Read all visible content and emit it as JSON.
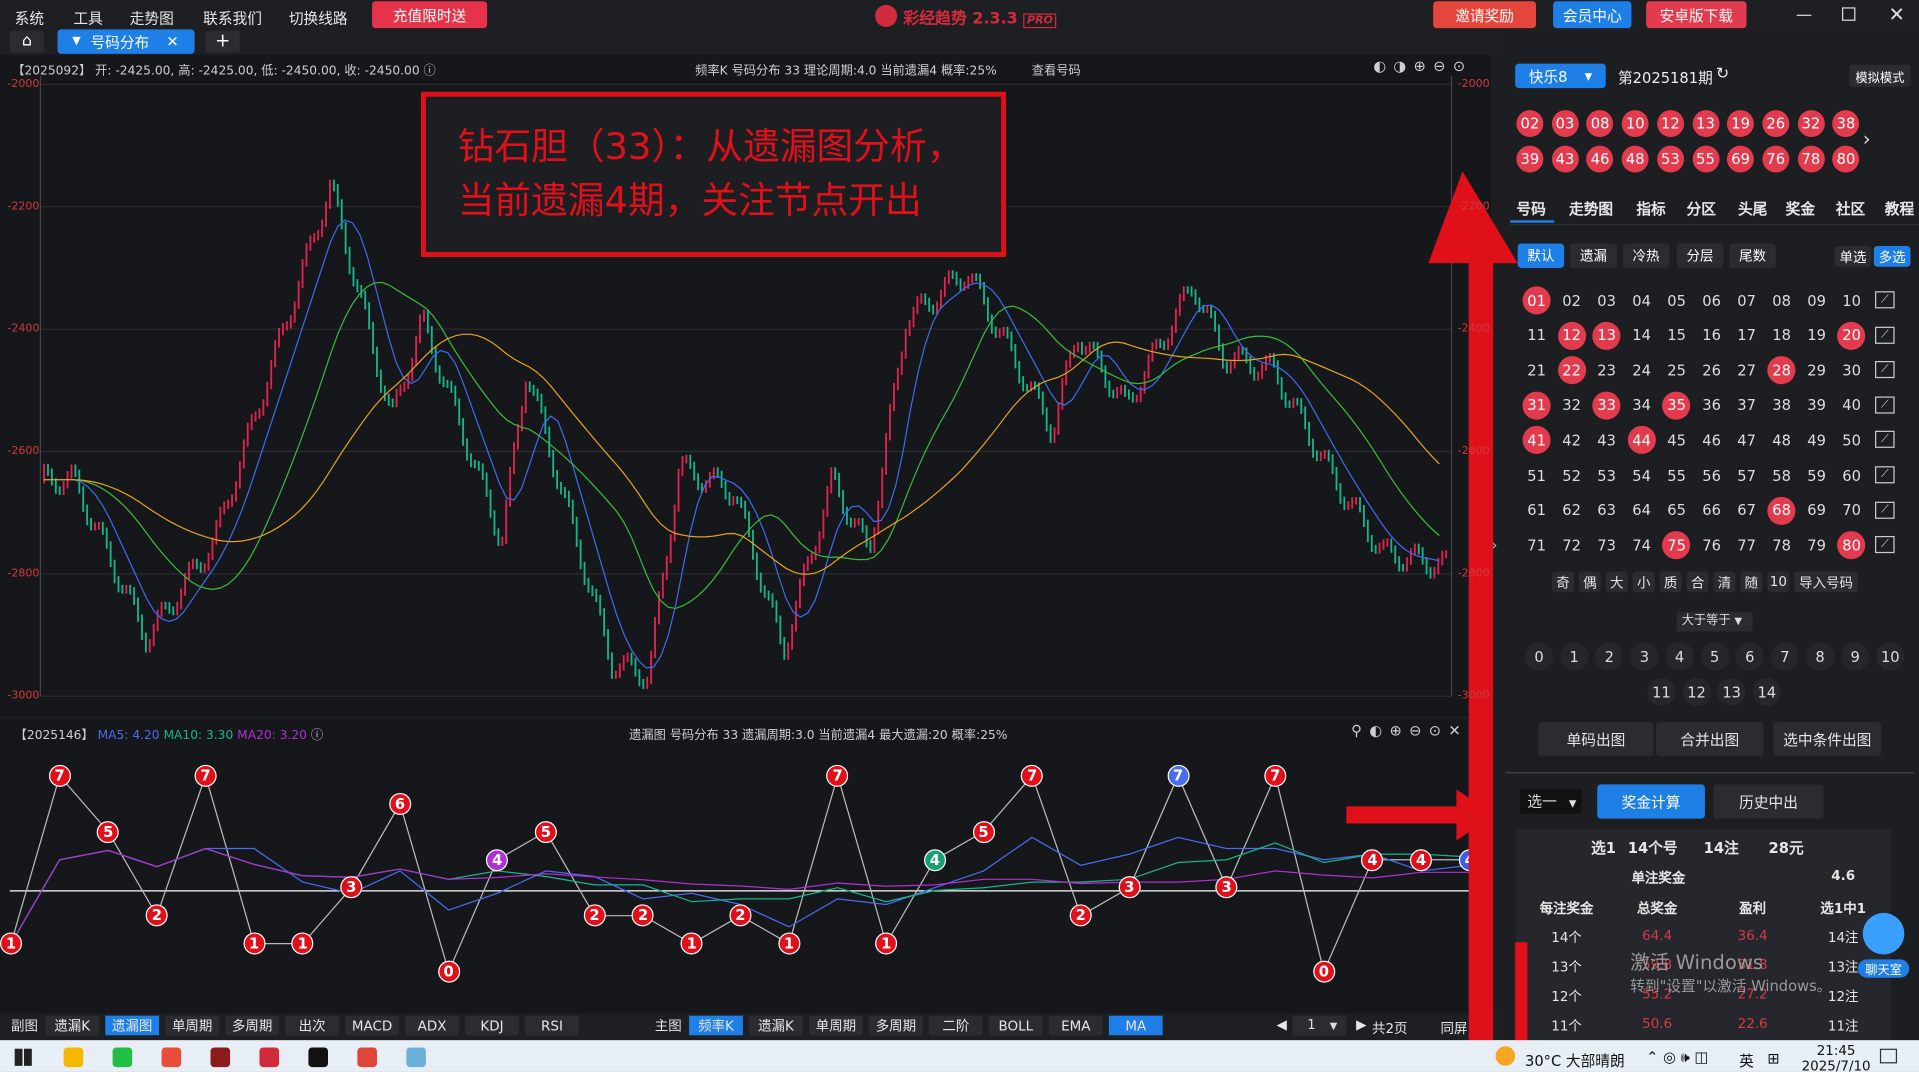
{
  "menu": [
    "系统",
    "工具",
    "走势图",
    "联系我们",
    "切换线路"
  ],
  "promo_button": "充值限时送",
  "app_title": "彩经趋势 2.3.3",
  "app_badge": "PRO",
  "invite_label": "邀请奖励",
  "member_label": "会员中心",
  "android_label": "安卓版下载",
  "tab_label": "号码分布",
  "main_header": {
    "period": "【2025092】",
    "ohlc": "开: -2425.00, 高: -2425.00, 低: -2450.00, 收: -2450.00",
    "right": "频率K  号码分布  33    理论周期:4.0  当前遗漏4  概率:25%",
    "view": "查看号码"
  },
  "y_axis": [
    "-2000",
    "-2200",
    "-2400",
    "-2600",
    "-2800",
    "-3000"
  ],
  "annotation": [
    "钻石胆（33）：从遗漏图分析，",
    "当前遗漏4期，关注节点开出"
  ],
  "sub_header": {
    "period": "【2025146】",
    "ma5": "MA5: 4.20",
    "ma10": "MA10: 3.30",
    "ma20": "MA20: 3.20",
    "right": "遗漏图  号码分布  33    遗漏周期:3.0  当前遗漏4  最大遗漏:20  概率:25%"
  },
  "chart_data": {
    "type": "line",
    "title": "遗漏图",
    "series": [
      {
        "name": "33",
        "values": [
          1,
          7,
          5,
          2,
          7,
          1,
          1,
          3,
          6,
          0,
          4,
          5,
          2,
          2,
          1,
          2,
          1,
          7,
          1,
          4,
          5,
          7,
          2,
          3,
          7,
          3,
          7,
          0,
          4,
          4,
          4
        ]
      }
    ]
  },
  "bottom_left": [
    "副图",
    "遗漏K",
    "遗漏图",
    "单周期",
    "多周期",
    "出次",
    "MACD",
    "ADX",
    "KDJ",
    "RSI"
  ],
  "bottom_right": [
    "主图",
    "频率K",
    "遗漏K",
    "单周期",
    "多周期",
    "二阶",
    "BOLL",
    "EMA",
    "MA"
  ],
  "page": {
    "current": "1",
    "total": "共2页",
    "sync": "同屏"
  },
  "right": {
    "lottery": "快乐8",
    "issue": "第2025181期",
    "mode": "模拟模式",
    "drawn": [
      "02",
      "03",
      "08",
      "10",
      "12",
      "13",
      "19",
      "26",
      "32",
      "38",
      "39",
      "43",
      "46",
      "48",
      "53",
      "55",
      "69",
      "76",
      "78",
      "80"
    ],
    "tabs": [
      "号码",
      "走势图",
      "指标",
      "分区",
      "头尾",
      "奖金",
      "社区",
      "教程"
    ],
    "subtabs": [
      "默认",
      "遗漏",
      "冷热",
      "分层",
      "尾数"
    ],
    "single": "单选",
    "multi": "多选",
    "selected": [
      "01",
      "12",
      "13",
      "20",
      "22",
      "28",
      "31",
      "33",
      "35",
      "41",
      "44",
      "68",
      "75",
      "80"
    ],
    "filters": [
      "奇",
      "偶",
      "大",
      "小",
      "质",
      "合",
      "清",
      "随",
      "10",
      "导入号码"
    ],
    "cond": "大于等于",
    "counts": [
      "0",
      "1",
      "2",
      "3",
      "4",
      "5",
      "6",
      "7",
      "8",
      "9",
      "10",
      "11",
      "12",
      "13",
      "14"
    ],
    "actions": [
      "单码出图",
      "合并出图",
      "选中条件出图"
    ],
    "pick": "选一",
    "calc": "奖金计算",
    "history": "历史中出",
    "summary": [
      "选1",
      "14个号",
      "14注",
      "28元"
    ],
    "single_prize_label": "单注奖金",
    "single_prize": "4.6",
    "table_headers": [
      "每注奖金",
      "总奖金",
      "盈利",
      "选1中1"
    ],
    "rows": [
      [
        "14个",
        "64.4",
        "36.4",
        "14注"
      ],
      [
        "13个",
        "59.8",
        "31.8",
        "13注"
      ],
      [
        "12个",
        "55.2",
        "27.2",
        "12注"
      ],
      [
        "11个",
        "50.6",
        "22.6",
        "11注"
      ]
    ],
    "chat": "聊天室",
    "watermark1": "激活 Windows",
    "watermark2": "转到\"设置\"以激活 Windows。"
  },
  "taskbar": {
    "weather": "30°C  大部晴朗",
    "lang": "英",
    "time": "21:45",
    "date": "2025/7/10"
  },
  "colors": {
    "accent": "#1e7fe6",
    "ball": "#e23b4e",
    "up": "#e0244f",
    "down": "#18b48c"
  }
}
